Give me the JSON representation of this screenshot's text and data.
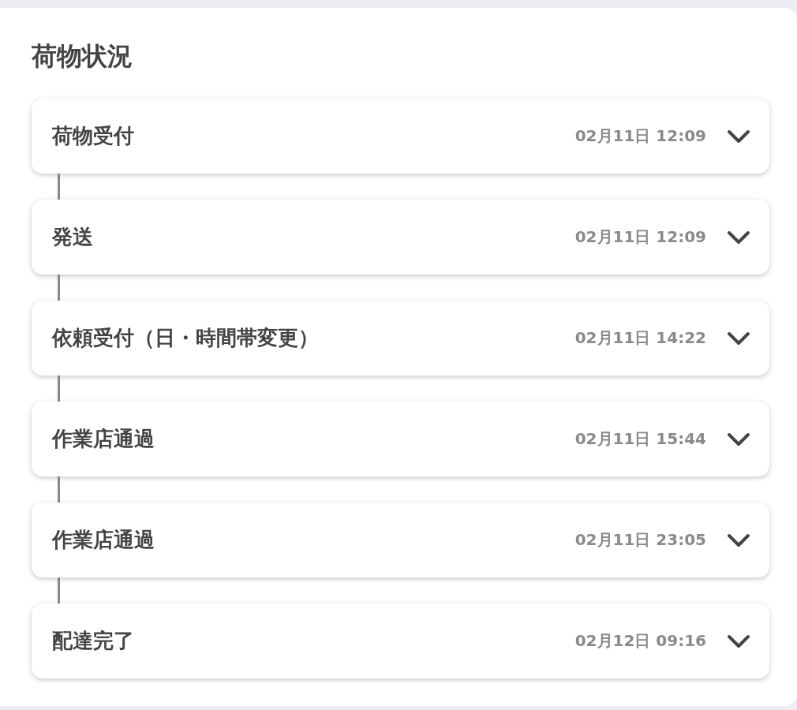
{
  "title": "荷物状況",
  "events": [
    {
      "label": "荷物受付",
      "time": "02月11日 12:09",
      "expanded": false
    },
    {
      "label": "発送",
      "time": "02月11日 12:09",
      "expanded": false
    },
    {
      "label": "依頼受付（日・時間帯変更）",
      "time": "02月11日 14:22",
      "expanded": false
    },
    {
      "label": "作業店通過",
      "time": "02月11日 15:44",
      "expanded": false
    },
    {
      "label": "作業店通過",
      "time": "02月11日 23:05",
      "expanded": false
    },
    {
      "label": "配達完了",
      "time": "02月12日 09:16",
      "expanded": false
    }
  ]
}
